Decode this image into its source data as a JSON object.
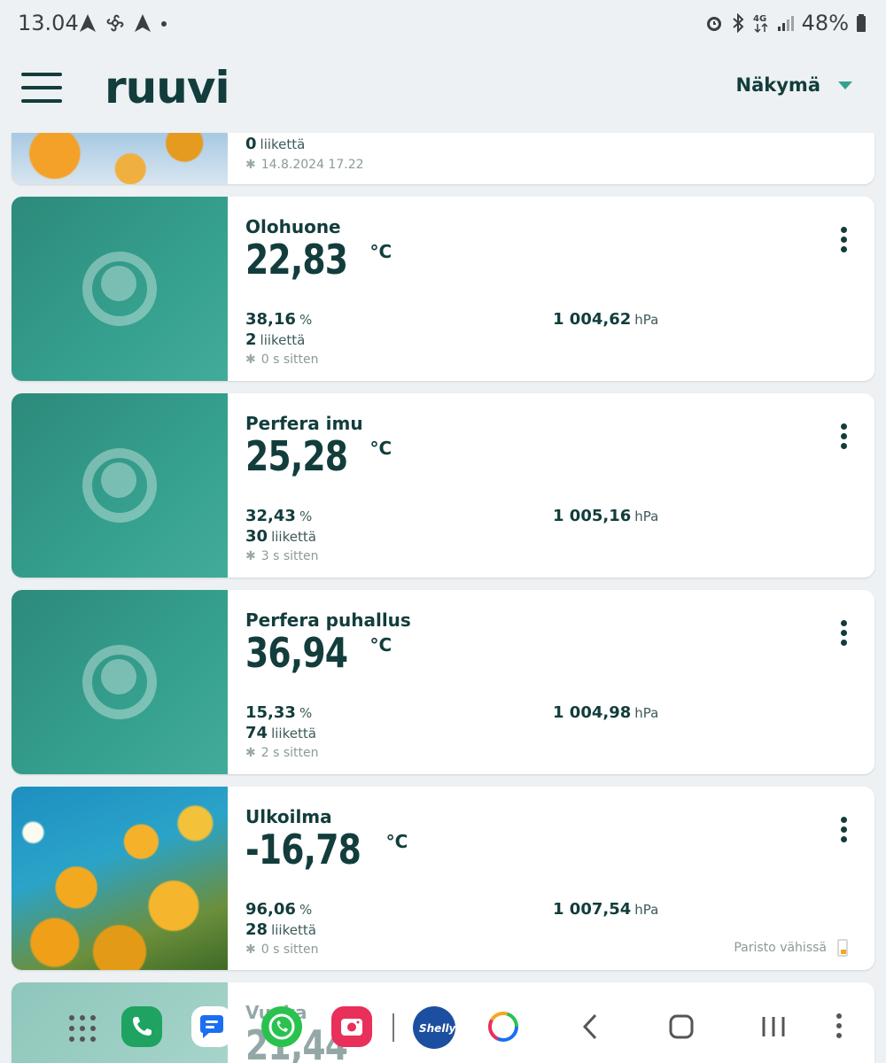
{
  "status_bar": {
    "time": "13.04",
    "battery_percent": "48%"
  },
  "header": {
    "logo": "ruuvi",
    "view_label": "Näkymä"
  },
  "cards": [
    {
      "name": "",
      "movement_value": "0",
      "movement_unit": "liikettä",
      "updated": "14.8.2024 17.22",
      "image": "autumn-leaves"
    },
    {
      "name": "Olohuone",
      "temperature": "22,83",
      "temp_unit": "°C",
      "humidity_value": "38,16",
      "humidity_unit": "%",
      "pressure_value": "1 004,62",
      "pressure_unit": "hPa",
      "movement_value": "2",
      "movement_unit": "liikettä",
      "updated": "0 s sitten",
      "image": "default-teal"
    },
    {
      "name": "Perfera imu",
      "temperature": "25,28",
      "temp_unit": "°C",
      "humidity_value": "32,43",
      "humidity_unit": "%",
      "pressure_value": "1 005,16",
      "pressure_unit": "hPa",
      "movement_value": "30",
      "movement_unit": "liikettä",
      "updated": "3 s sitten",
      "image": "default-teal"
    },
    {
      "name": "Perfera puhallus",
      "temperature": "36,94",
      "temp_unit": "°C",
      "humidity_value": "15,33",
      "humidity_unit": "%",
      "pressure_value": "1 004,98",
      "pressure_unit": "hPa",
      "movement_value": "74",
      "movement_unit": "liikettä",
      "updated": "2 s sitten",
      "image": "default-teal"
    },
    {
      "name": "Ulkoilma",
      "temperature": "-16,78",
      "temp_unit": "°C",
      "humidity_value": "96,06",
      "humidity_unit": "%",
      "pressure_value": "1 007,54",
      "pressure_unit": "hPa",
      "movement_value": "28",
      "movement_unit": "liikettä",
      "updated": "0 s sitten",
      "battery_warning": "Paristo vähissä",
      "image": "yellow-poppies"
    },
    {
      "name": "Vuoka",
      "temperature": "21,44",
      "image": "default-teal"
    }
  ],
  "dock": {
    "apps": [
      "app-drawer-icon",
      "phone-icon",
      "messages-icon",
      "whatsapp-icon",
      "camera-icon",
      "shelly-icon",
      "ring-app-icon"
    ],
    "shelly_label": "Shelly",
    "nav": [
      "back-icon",
      "home-icon",
      "recents-icon",
      "more-icon"
    ]
  },
  "colors": {
    "brand_dark": "#123d3c",
    "brand_teal": "#35a08f",
    "background": "#edf1f3",
    "battery_warning": "#f5a623"
  }
}
